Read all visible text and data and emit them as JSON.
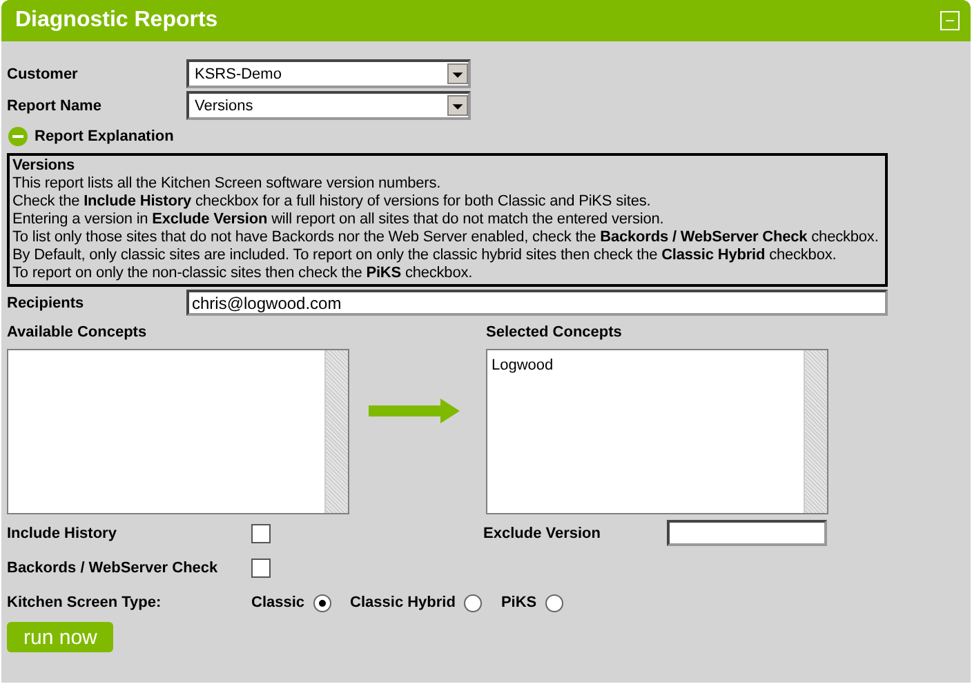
{
  "header": {
    "title": "Diagnostic Reports",
    "collapse_icon": "−"
  },
  "customer": {
    "label": "Customer",
    "value": "KSRS-Demo"
  },
  "report_name": {
    "label": "Report Name",
    "value": "Versions"
  },
  "explanation": {
    "label": "Report Explanation",
    "expanded": true,
    "title": "Versions",
    "lines": [
      "This report lists all the Kitchen Screen software version numbers.",
      "Check the **Include History** checkbox for a full history of versions for both Classic and PiKS sites.",
      "Entering a version in **Exclude Version** will report on all sites that do not match the entered version.",
      "To list only those sites that do not have Backords nor the Web Server enabled, check the **Backords / WebServer Check** checkbox.",
      "By Default, only classic sites are included. To report on only the classic hybrid sites then check the **Classic Hybrid** checkbox.",
      "To report on only the non-classic sites then check the **PiKS** checkbox."
    ]
  },
  "recipients": {
    "label": "Recipients",
    "value": "chris@logwood.com"
  },
  "available_concepts": {
    "label": "Available Concepts"
  },
  "selected_concepts": {
    "label": "Selected Concepts",
    "items": [
      "Logwood"
    ]
  },
  "include_history": {
    "label": "Include History",
    "checked": false
  },
  "exclude_version": {
    "label": "Exclude Version"
  },
  "backords_check": {
    "label": "Backords / WebServer Check",
    "checked": false
  },
  "kitchen_screen_type": {
    "label": "Kitchen Screen Type:",
    "options": [
      {
        "label": "Classic",
        "selected": true
      },
      {
        "label": "Classic Hybrid",
        "selected": false
      },
      {
        "label": "PiKS",
        "selected": false
      }
    ]
  },
  "run_button": "run now"
}
